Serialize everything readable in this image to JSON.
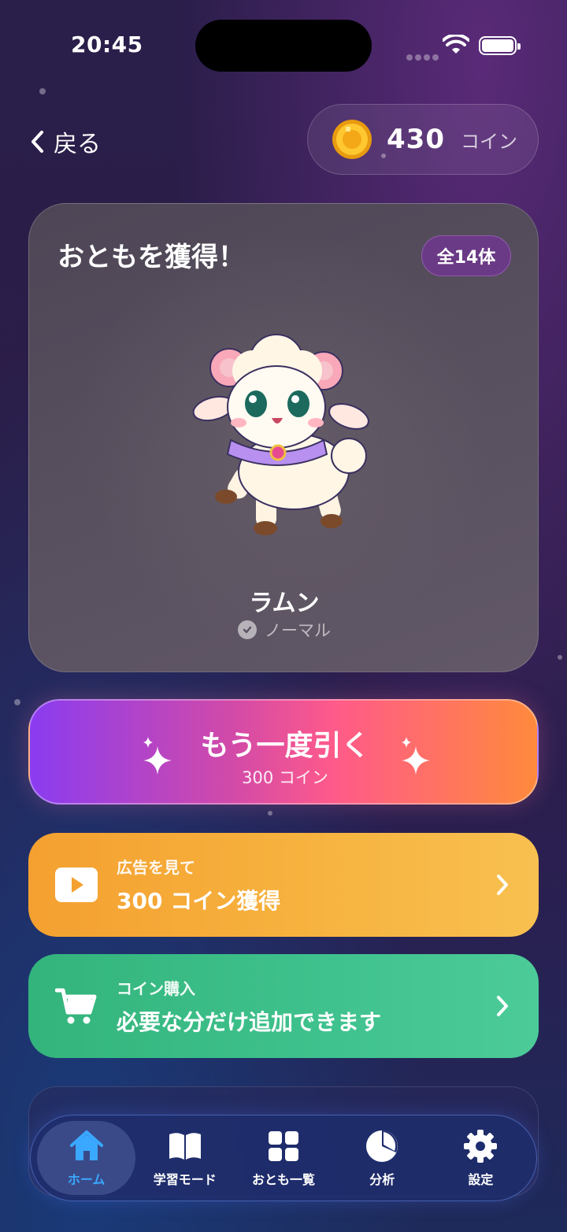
{
  "status": {
    "time": "20:45"
  },
  "header": {
    "back_label": "戻る",
    "coin_value": "430",
    "coin_unit": "コイン"
  },
  "card": {
    "title": "おともを獲得！",
    "count_badge": "全14体",
    "character_name": "ラムン",
    "rarity": "ノーマル"
  },
  "draw_button": {
    "label": "もう一度引く",
    "cost": "300 コイン"
  },
  "ad_button": {
    "small": "広告を見て",
    "big": "300 コイン獲得"
  },
  "shop_button": {
    "small": "コイン購入",
    "big": "必要な分だけ追加できます"
  },
  "tabs": [
    {
      "label": "ホーム",
      "icon": "home-icon",
      "active": true
    },
    {
      "label": "学習モード",
      "icon": "book-icon",
      "active": false
    },
    {
      "label": "おとも一覧",
      "icon": "grid-icon",
      "active": false
    },
    {
      "label": "分析",
      "icon": "pie-chart-icon",
      "active": false
    },
    {
      "label": "設定",
      "icon": "gear-icon",
      "active": false
    }
  ],
  "colors": {
    "draw_gradient": [
      "#8a3cf0",
      "#ff5a8a",
      "#ff8a3c"
    ],
    "ad_button": "#f4a030",
    "shop_button": "#40c28e",
    "tab_active": "#3aa8ff"
  }
}
